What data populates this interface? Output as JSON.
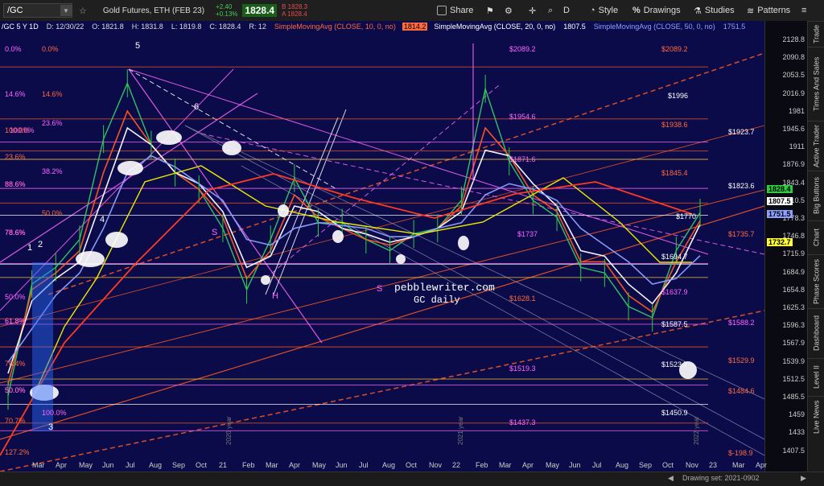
{
  "toolbar": {
    "symbol": "/GC",
    "instrument": "Gold Futures, ETH (FEB 23)",
    "change_abs": "+2.40",
    "change_pct": "+0.13%",
    "last": "1828.4",
    "bid": "B 1828.3",
    "ask": "A 1828.4",
    "share": "Share",
    "timeframe": "D",
    "style": "Style",
    "drawings": "Drawings",
    "studies": "Studies",
    "patterns": "Patterns"
  },
  "legend": {
    "header": "/GC 5 Y 1D",
    "date": "D: 12/30/22",
    "open": "O: 1821.8",
    "high": "H: 1831.8",
    "low": "L: 1819.8",
    "close": "C: 1828.4",
    "r": "R: 12",
    "sma10": "SimpleMovingAvg (CLOSE, 10, 0, no)",
    "sma10_val": "1814.2",
    "sma20": "SimpleMovingAvg (CLOSE, 20, 0, no)",
    "sma20_val": "1807.5",
    "sma50": "SimpleMovingAvg (CLOSE, 50, 0, no)",
    "sma50_val": "1751.5"
  },
  "price_axis": [
    "2128.8",
    "2090.8",
    "2053.5",
    "2016.9",
    "1981",
    "1945.6",
    "1911",
    "1876.9",
    "1843.4",
    "1810.5",
    "1778.3",
    "1746.8",
    "1715.9",
    "1684.9",
    "1654.8",
    "1625.3",
    "1596.3",
    "1567.9",
    "1539.9",
    "1512.5",
    "1485.5",
    "1459",
    "1433",
    "1407.5"
  ],
  "price_tags": [
    {
      "label": "1828.4",
      "color": "#2ecc40"
    },
    {
      "label": "1807.5",
      "color": "#ffffff"
    },
    {
      "label": "1751.5",
      "color": "#8da0ff"
    },
    {
      "label": "1732.7",
      "color": "#ffff33"
    }
  ],
  "x_axis": [
    "Mar",
    "Apr",
    "May",
    "Jun",
    "Jul",
    "Aug",
    "Sep",
    "Oct",
    "21",
    "Feb",
    "Mar",
    "Apr",
    "May",
    "Jun",
    "Jul",
    "Aug",
    "Oct",
    "Nov",
    "22",
    "Feb",
    "Mar",
    "Apr",
    "May",
    "Jun",
    "Jul",
    "Aug",
    "Sep",
    "Oct",
    "Nov",
    "23",
    "Mar",
    "Apr"
  ],
  "fib_labels_left": [
    "0.0%",
    "0.0%",
    "14.6%",
    "14.6%",
    "23.6%",
    "100.0%",
    "100.0%",
    "23.6%",
    "38.2%",
    "88.6%",
    "88.6%",
    "50.0%",
    "78.6%",
    "78.6%",
    "50.0%",
    "61.8%",
    "61.8%",
    "50.0%",
    "50.0%",
    "76.4%",
    "78.6%",
    "70.7%",
    "100.0%",
    "127.2%"
  ],
  "level_labels": [
    "$2089.2",
    "$2089.2",
    "$1996",
    "$1954.6",
    "$1938.6",
    "$1923.7",
    "$1871.6",
    "$1845.4",
    "$1823.6",
    "$1737",
    "$1735.7",
    "$1694.7",
    "$1637.9",
    "$1628.1",
    "$1587.5",
    "$1588.2",
    "$1529.9",
    "$1523.7",
    "$1519.3",
    "$1484.6",
    "$1450.9",
    "$1437.3",
    "$-198.9",
    "$1770"
  ],
  "wave_labels": [
    "5",
    "6",
    "4",
    "1",
    "2",
    "3",
    "S",
    "H",
    "S"
  ],
  "watermark_site": "pebblewriter.com",
  "watermark_sub": "GC daily",
  "year_labels": [
    "2020 year",
    "2021 year",
    "2022 year"
  ],
  "sidebar": [
    "Trade",
    "Times And Sales",
    "Active Trader",
    "Big Buttons",
    "Chart",
    "Phase Scores",
    "Dashboard",
    "Level II",
    "Live News"
  ],
  "drawing_set": "Drawing set: 2021-0902",
  "chart_data": {
    "type": "line",
    "title": "/GC 5 Y 1D",
    "x": [
      "Mar 20",
      "Apr",
      "May",
      "Jun",
      "Jul",
      "Aug",
      "Sep",
      "Oct",
      "Jan 21",
      "Feb",
      "Mar",
      "Apr",
      "May",
      "Jun",
      "Jul",
      "Aug",
      "Oct",
      "Nov",
      "Jan 22",
      "Feb",
      "Mar",
      "Apr",
      "May",
      "Jun",
      "Jul",
      "Aug",
      "Sep",
      "Oct",
      "Nov",
      "Dec 22"
    ],
    "series": [
      {
        "name": "/GC",
        "values": [
          1500,
          1700,
          1730,
          1780,
          1960,
          2060,
          1950,
          1900,
          1870,
          1800,
          1690,
          1780,
          1890,
          1810,
          1810,
          1780,
          1760,
          1790,
          1800,
          1850,
          2050,
          1920,
          1850,
          1820,
          1730,
          1720,
          1660,
          1640,
          1760,
          1828
        ]
      },
      {
        "name": "SimpleMovingAvg (CLOSE, 10, 0, no)",
        "values": [
          1520,
          1690,
          1720,
          1760,
          1900,
          2010,
          1950,
          1900,
          1870,
          1820,
          1710,
          1760,
          1860,
          1820,
          1800,
          1780,
          1770,
          1785,
          1800,
          1840,
          1980,
          1930,
          1860,
          1830,
          1740,
          1740,
          1680,
          1650,
          1740,
          1814
        ]
      },
      {
        "name": "SimpleMovingAvg (CLOSE, 20, 0, no)",
        "values": [
          1540,
          1670,
          1710,
          1740,
          1860,
          1980,
          1950,
          1900,
          1880,
          1830,
          1730,
          1750,
          1840,
          1830,
          1800,
          1790,
          1775,
          1785,
          1800,
          1830,
          1940,
          1930,
          1880,
          1840,
          1760,
          1750,
          1700,
          1665,
          1720,
          1807
        ]
      },
      {
        "name": "SimpleMovingAvg (CLOSE, 50, 0, no)",
        "values": [
          1560,
          1620,
          1680,
          1720,
          1800,
          1900,
          1930,
          1910,
          1880,
          1850,
          1780,
          1770,
          1800,
          1810,
          1805,
          1800,
          1785,
          1785,
          1800,
          1810,
          1860,
          1880,
          1870,
          1850,
          1800,
          1770,
          1740,
          1700,
          1710,
          1751
        ]
      }
    ],
    "ylim": [
      1393,
      2140
    ],
    "grid": false
  }
}
